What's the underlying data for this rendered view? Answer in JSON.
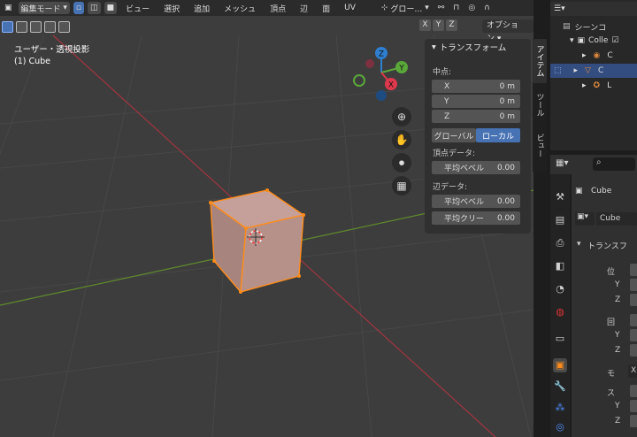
{
  "header": {
    "mode_label": "編集モード",
    "menus": [
      "ビュー",
      "選択",
      "追加",
      "メッシュ",
      "頂点",
      "辺",
      "面",
      "UV"
    ],
    "transform_orientation": "グロー…",
    "axis_buttons": [
      "X",
      "Y",
      "Z"
    ],
    "options_label": "オプション"
  },
  "viewport": {
    "view_name": "ユーザー・透視投影",
    "object_name": "(1) Cube",
    "gizmo_labels": {
      "z": "Z",
      "y": "Y",
      "x": "X"
    }
  },
  "npanel": {
    "title": "トランスフォーム",
    "median_label": "中点:",
    "x_label": "X",
    "x_value": "0 m",
    "y_label": "Y",
    "y_value": "0 m",
    "z_label": "Z",
    "z_value": "0 m",
    "global_label": "グローバル",
    "local_label": "ローカル",
    "vertex_data_label": "頂点データ:",
    "vertex_bevel_label": "平均ベベル",
    "vertex_bevel_value": "0.00",
    "edge_data_label": "辺データ:",
    "edge_bevel_label": "平均ベベル",
    "edge_bevel_value": "0.00",
    "edge_crease_label": "平均クリー",
    "edge_crease_value": "0.00"
  },
  "sidebar_tabs": [
    "アイテム",
    "ツール",
    "ビュー"
  ],
  "outliner": {
    "scene_label": "シーンコ",
    "collection_label": "Colle",
    "items": [
      {
        "label": "C"
      },
      {
        "label": "C"
      },
      {
        "label": "L"
      }
    ]
  },
  "properties": {
    "object_name": "Cube",
    "mesh_name": "Cube",
    "section_title": "トランスフ",
    "location_label": "位",
    "rotation_label": "回",
    "mode_label": "モ",
    "mode_value": "X",
    "scale_label": "ス",
    "y_label": "Y",
    "z_label": "Z"
  },
  "colors": {
    "accent": "#4772b3",
    "cube_fill": "#b6918a",
    "selection": "#ff8c1a",
    "x_axis": "#e0384c",
    "y_axis": "#5aa83a",
    "z_axis": "#2f7fd0"
  }
}
